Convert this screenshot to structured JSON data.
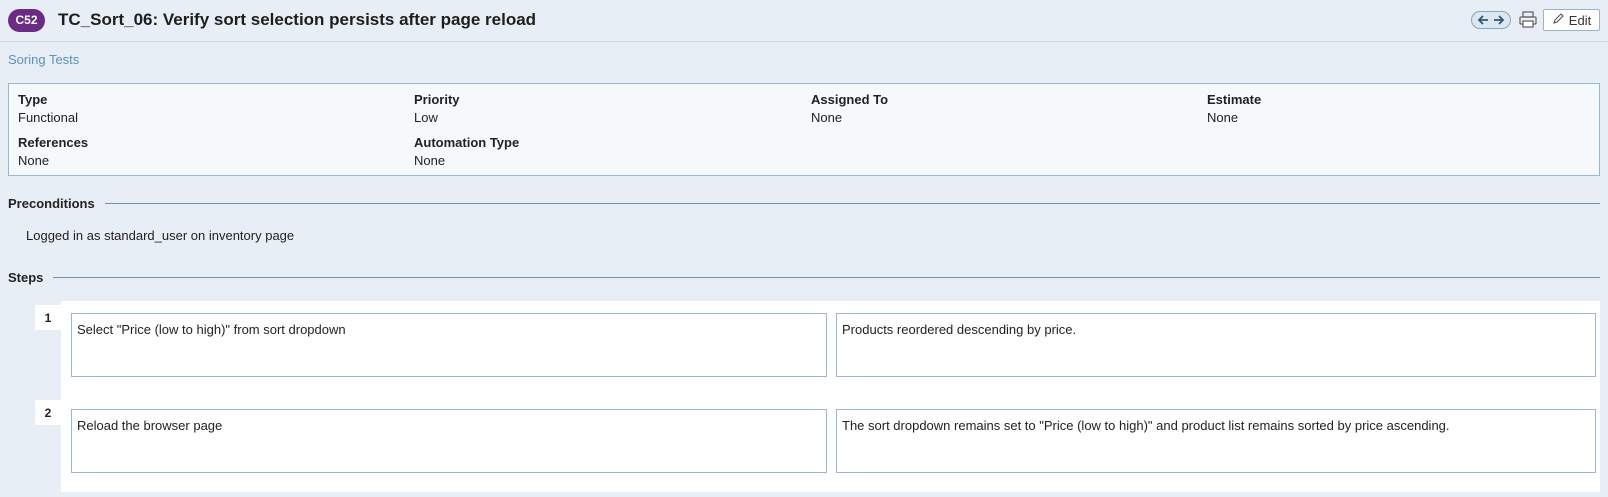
{
  "header": {
    "case_id": "C52",
    "title": "TC_Sort_06: Verify sort selection persists after page reload",
    "edit_label": "Edit"
  },
  "section": {
    "name": "Soring Tests"
  },
  "fields": {
    "type_label": "Type",
    "type_value": "Functional",
    "priority_label": "Priority",
    "priority_value": "Low",
    "assigned_label": "Assigned To",
    "assigned_value": "None",
    "estimate_label": "Estimate",
    "estimate_value": "None",
    "references_label": "References",
    "references_value": "None",
    "automation_label": "Automation Type",
    "automation_value": "None"
  },
  "preconditions": {
    "heading": "Preconditions",
    "text": "Logged in as standard_user on inventory page"
  },
  "steps": {
    "heading": "Steps",
    "items": [
      {
        "number": "1",
        "action": "Select \"Price (low to high)\" from sort dropdown",
        "expected": "Products reordered descending by price."
      },
      {
        "number": "2",
        "action": "Reload the browser page",
        "expected": "The sort dropdown remains set to \"Price (low to high)\" and product list remains sorted by price ascending."
      }
    ]
  },
  "colors": {
    "badge": "#6b2a84",
    "link": "#5c8fbf",
    "border": "#9bb6cf"
  },
  "icons": {
    "prev": "arrow-left-icon",
    "next": "arrow-right-icon",
    "print": "printer-icon",
    "edit": "pencil-icon"
  }
}
